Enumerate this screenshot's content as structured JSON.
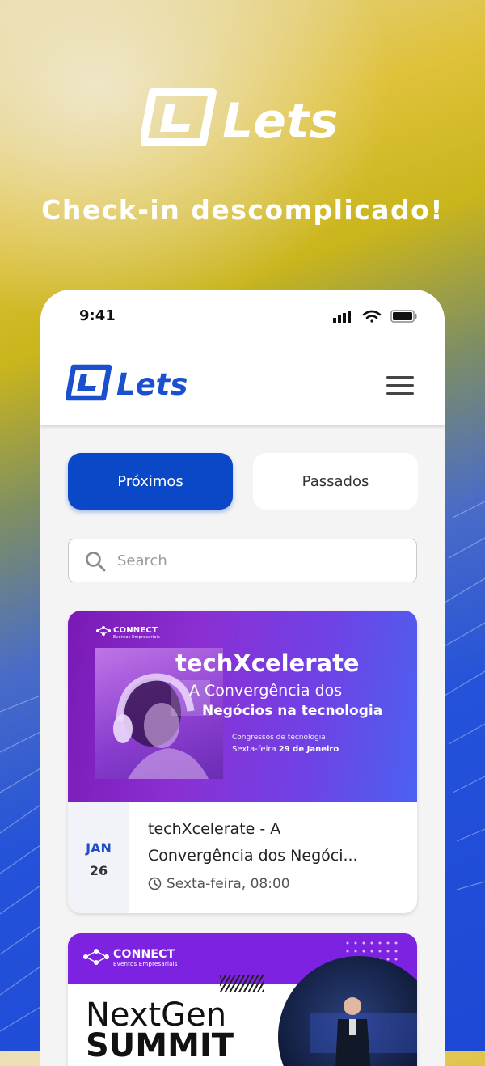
{
  "promo": {
    "logo_text": "Lets",
    "tagline": "Check-in descomplicado!"
  },
  "status_bar": {
    "time": "9:41",
    "icons": [
      "signal-icon",
      "wifi-icon",
      "battery-icon"
    ]
  },
  "header": {
    "logo_text": "Lets",
    "menu_icon": "hamburger-menu-icon"
  },
  "tabs": [
    {
      "label": "Próximos",
      "active": true
    },
    {
      "label": "Passados",
      "active": false
    }
  ],
  "search": {
    "placeholder": "Search",
    "value": ""
  },
  "events": [
    {
      "banner": {
        "brand": "CONNECT",
        "brand_sub": "Eventos Empresariais",
        "title": "techXcelerate",
        "subtitle_1": "A Convergência dos",
        "subtitle_2": "Negócios na tecnologia",
        "meta_1": "Congressos de tecnologia",
        "meta_2_prefix": "Sexta-feira",
        "meta_2_date": "29 de Janeiro"
      },
      "month": "JAN",
      "day": "26",
      "title": "techXcelerate - A Convergência dos Negóci...",
      "title_line1": "techXcelerate - A",
      "title_line2": "Convergência dos Negóci...",
      "time": "Sexta-feira, 08:00"
    },
    {
      "banner": {
        "brand": "CONNECT",
        "brand_sub": "Eventos Empresariais",
        "title_1": "NextGen",
        "title_2": "SUMMIT"
      }
    }
  ],
  "colors": {
    "primary": "#0b48c8",
    "logo_blue": "#1a4fd0",
    "promo_yellow": "#dfc13a",
    "promo_blue": "#1d48d6"
  }
}
